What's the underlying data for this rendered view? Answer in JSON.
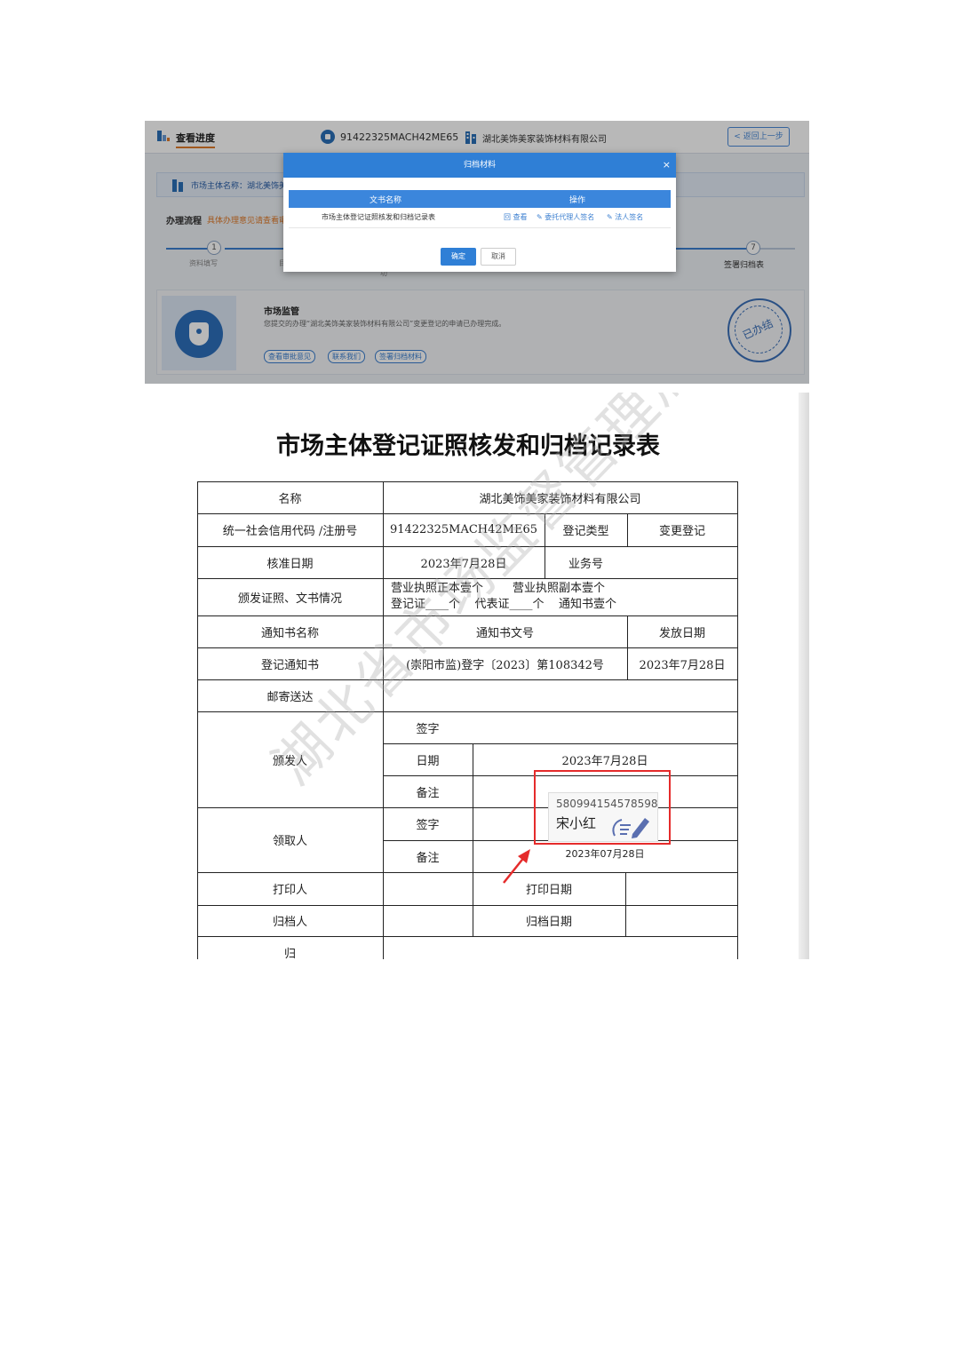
{
  "header": {
    "title": "查看进度",
    "credit_code": "91422325MACH42ME65",
    "company": "湖北美饰美家装饰材料有限公司",
    "back_label": "< 返回上一步"
  },
  "subject_bar": {
    "label": "市场主体名称：湖北美饰美"
  },
  "flow": {
    "title": "办理流程",
    "hint": "具体办理意见请查看审",
    "steps": [
      {
        "num": "1",
        "label": "资料填写"
      },
      {
        "num": "7",
        "label": "签署归档表"
      }
    ],
    "stub_left": "目",
    "stub_mid": "功"
  },
  "card": {
    "title": "市场监管",
    "desc": "您提交的办理“湖北美饰美家装饰材料有限公司”变更登记的申请已办理完成。",
    "buttons": [
      "查看审批意见",
      "联系我们",
      "签署归档材料"
    ],
    "stamp": "已办结"
  },
  "modal": {
    "title": "归档材料",
    "close": "×",
    "col_name": "文书名称",
    "col_ops": "操作",
    "rows": [
      {
        "name": "市场主体登记证照核发和归档记录表",
        "ops": [
          "回 查看",
          "✎ 委托代理人签名",
          "✎ 法人签名"
        ]
      }
    ],
    "ok": "确定",
    "cancel": "取消"
  },
  "doc": {
    "title": "市场主体登记证照核发和归档记录表",
    "r1": {
      "label": "名称",
      "value": "湖北美饰美家装饰材料有限公司"
    },
    "r2": {
      "label": "统一社会信用代码 /注册号",
      "code": "91422325MACH42ME65",
      "type_label": "登记类型",
      "type_value": "变更登记"
    },
    "r3": {
      "label": "核准日期",
      "date": "2023年7月28日",
      "biz_label": "业务号"
    },
    "r4": {
      "label": "颁发证照、文书情况",
      "line1": "营业执照正本壹个        营业执照副本壹个",
      "line2": "登记证____个    代表证____个    通知书壹个"
    },
    "r5": {
      "label": "通知书名称",
      "mid": "通知书文号",
      "right": "发放日期"
    },
    "r6": {
      "label": "登记通知书",
      "mid": "(崇阳市监)登字〔2023〕第108342号",
      "right": "2023年7月28日"
    },
    "r7": {
      "label": "邮寄送达"
    },
    "issuer": {
      "label": "颁发人",
      "sign": "签字",
      "date_label": "日期",
      "date": "2023年7月28日",
      "note": "备注"
    },
    "receiver": {
      "label": "领取人",
      "sign": "签字",
      "note": "备注",
      "date": "2023年07月28日"
    },
    "printer": {
      "label": "打印人",
      "date_label": "打印日期"
    },
    "archiver": {
      "label": "归档人",
      "date_label": "归档日期"
    },
    "last": {
      "label": "归"
    },
    "signature": {
      "code": "580994154578598",
      "name": "宋小红"
    },
    "watermark": "湖北省市场监督管理局"
  },
  "colors": {
    "accent": "#2f7fd6",
    "red": "#e52b2b"
  }
}
